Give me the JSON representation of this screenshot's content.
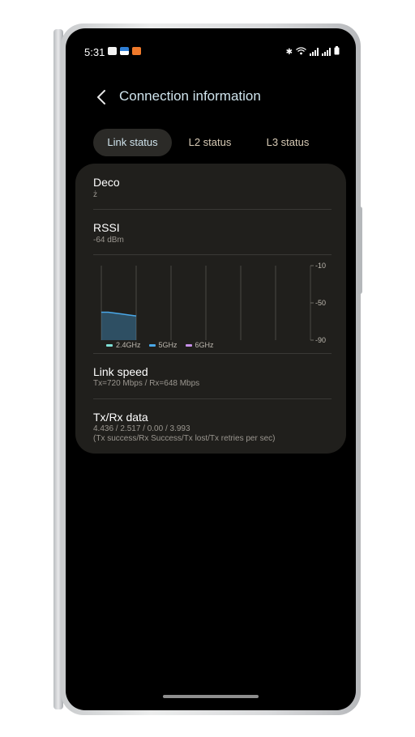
{
  "status_bar": {
    "time": "5:31",
    "left_icons": [
      "image-icon",
      "cloud-icon",
      "heart-icon"
    ],
    "right_icons": [
      "bluetooth-icon",
      "wifi-icon",
      "signal-icon",
      "signal-icon",
      "battery-icon"
    ]
  },
  "header": {
    "back_icon": "chevron-left-icon",
    "title": "Connection information"
  },
  "tabs": [
    {
      "label": "Link status",
      "active": true
    },
    {
      "label": "L2 status",
      "active": false
    },
    {
      "label": "L3 status",
      "active": false
    }
  ],
  "rows": {
    "network": {
      "title": "Deco",
      "value": "ż"
    },
    "rssi": {
      "title": "RSSI",
      "value": "-64 dBm"
    },
    "link_speed": {
      "title": "Link speed",
      "value": "Tx=720 Mbps / Rx=648 Mbps"
    },
    "txrx": {
      "title": "Tx/Rx data",
      "value": "4.436 / 2.517 / 0.00 / 3.993",
      "legend": "(Tx success/Rx Success/Tx lost/Tx retries per sec)"
    }
  },
  "chart_data": {
    "type": "area",
    "title": "",
    "y_tick_labels": [
      "-10",
      "-50",
      "-90"
    ],
    "ylim": [
      -90,
      -10
    ],
    "grid": true,
    "series": [
      {
        "name": "2.4GHz",
        "color": "#7fe0d6",
        "values": []
      },
      {
        "name": "5GHz",
        "color": "#4aa8e8",
        "values": [
          -60,
          -60,
          -61,
          -62,
          -63,
          -64
        ]
      },
      {
        "name": "6GHz",
        "color": "#c690e8",
        "values": []
      }
    ]
  },
  "colors": {
    "accent": "#cfe3ec",
    "tab_text": "#d8cbb6",
    "card_bg": "#201f1c"
  }
}
